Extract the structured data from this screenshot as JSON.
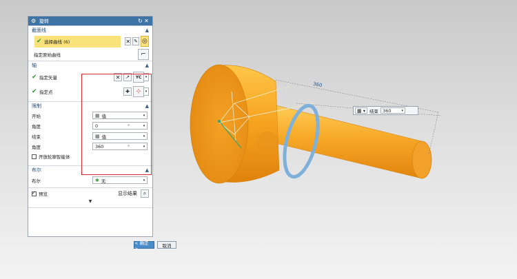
{
  "dialog": {
    "title": "旋转",
    "sections": {
      "section_curve": "截面线",
      "axis": "轴",
      "limits": "限制",
      "boolean": "布尔"
    },
    "curve": {
      "select_curve": "选择曲线 (6)",
      "specify_origin_curve": "指定原始曲线"
    },
    "axis_rows": {
      "specify_vector": "指定矢量",
      "specify_point": "指定点",
      "vector_type": "YC"
    },
    "limits": {
      "start_label": "开始",
      "start_value": "值",
      "start_angle_label": "角度",
      "start_angle": "0",
      "end_label": "结束",
      "end_value": "值",
      "end_angle_label": "角度",
      "end_angle": "360",
      "unit": "°",
      "open_profile": "开放轮廓智能体"
    },
    "boolean_row": {
      "label": "布尔",
      "value": "无"
    },
    "preview": "预览",
    "show_result": "显示结果",
    "ok": "< 确定 >",
    "cancel": "取消"
  },
  "viewport": {
    "float_label": "结束",
    "float_value": "360",
    "dim_value": "360",
    "colors": {
      "part": "#f5a623",
      "part_dark": "#e08a10",
      "ring": "#7fb0d9",
      "accent_red": "#e0262f"
    }
  }
}
